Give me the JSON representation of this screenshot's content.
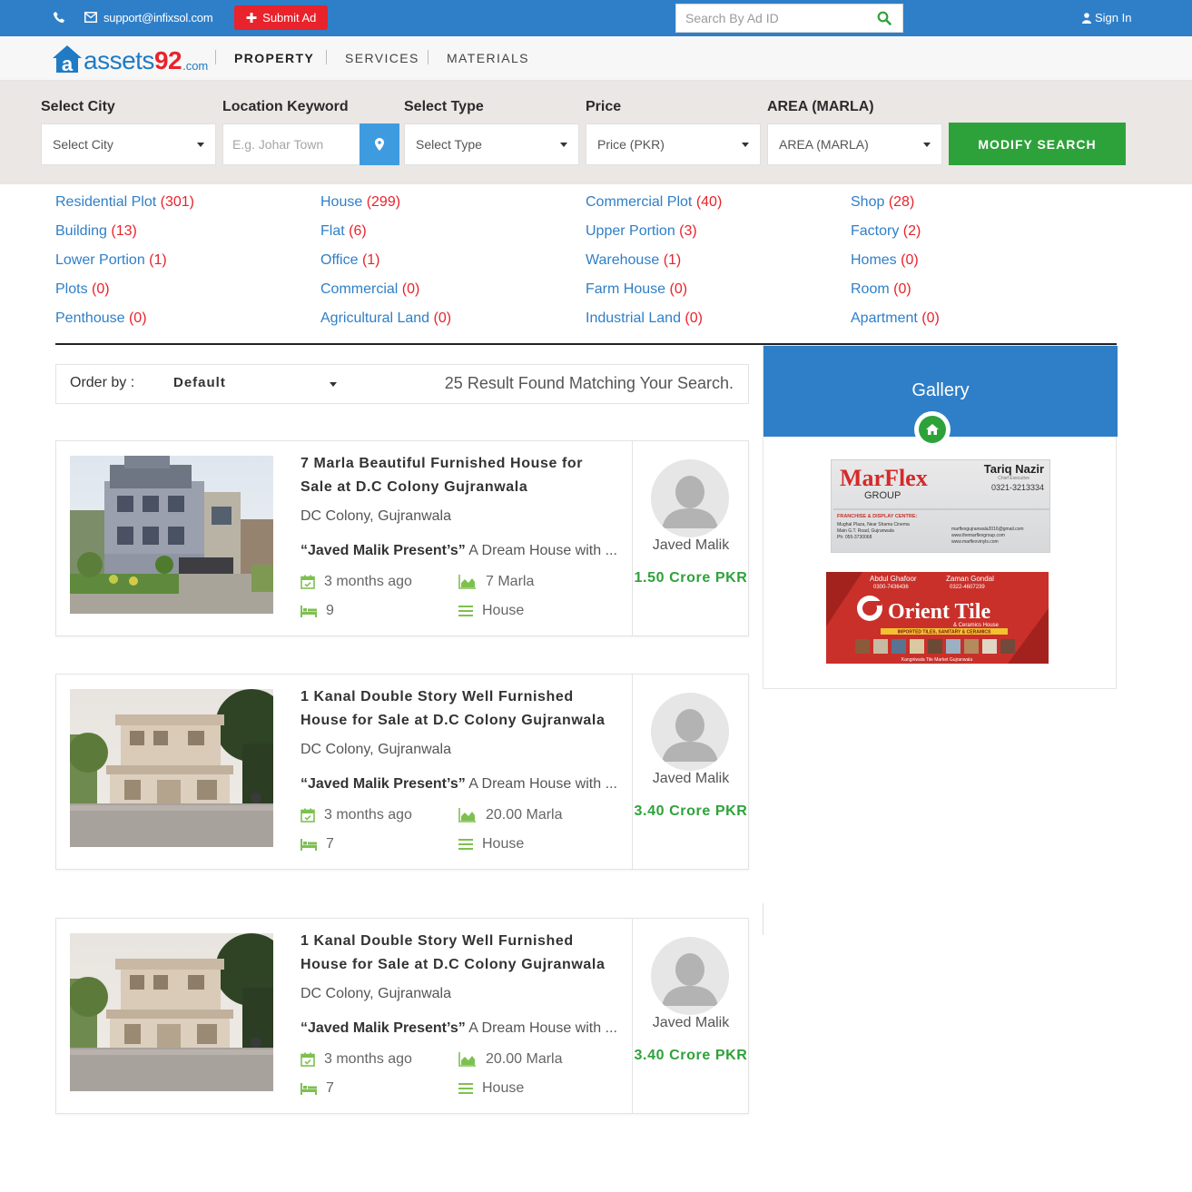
{
  "topbar": {
    "email": "support@infixsol.com",
    "submit_label": "Submit Ad",
    "search_placeholder": "Search By Ad ID",
    "signin_label": "Sign In",
    "bg_color": "#2f7fc8",
    "submit_color": "#e8232c"
  },
  "logo": {
    "part1": "assets",
    "part2": "92",
    "suffix": ".com"
  },
  "nav": {
    "items": [
      "PROPERTY",
      "SERVICES",
      "MATERIALS"
    ],
    "active": "PROPERTY"
  },
  "filter": {
    "city_label": "Select City",
    "city_value": "Select City",
    "keyword_label": "Location Keyword",
    "keyword_placeholder": "E.g. Johar Town",
    "type_label": "Select Type",
    "type_value": "Select Type",
    "price_label": "Price",
    "price_value": "Price (PKR)",
    "area_label": "AREA (MARLA)",
    "area_value": "AREA (MARLA)",
    "modify_label": "MODIFY SEARCH",
    "modify_color": "#2ea23a"
  },
  "categories": [
    {
      "name": "Residential Plot",
      "count": "(301)"
    },
    {
      "name": "House",
      "count": "(299)"
    },
    {
      "name": "Commercial Plot",
      "count": "(40)"
    },
    {
      "name": "Shop",
      "count": "(28)"
    },
    {
      "name": "Building",
      "count": "(13)"
    },
    {
      "name": "Flat",
      "count": "(6)"
    },
    {
      "name": "Upper Portion",
      "count": "(3)"
    },
    {
      "name": "Factory",
      "count": "(2)"
    },
    {
      "name": "Lower Portion",
      "count": "(1)"
    },
    {
      "name": "Office",
      "count": "(1)"
    },
    {
      "name": "Warehouse",
      "count": "(1)"
    },
    {
      "name": "Homes",
      "count": "(0)"
    },
    {
      "name": "Plots",
      "count": "(0)"
    },
    {
      "name": "Commercial",
      "count": "(0)"
    },
    {
      "name": "Farm House",
      "count": "(0)"
    },
    {
      "name": "Room",
      "count": "(0)"
    },
    {
      "name": "Penthouse",
      "count": "(0)"
    },
    {
      "name": "Agricultural Land",
      "count": "(0)"
    },
    {
      "name": "Industrial Land",
      "count": "(0)"
    },
    {
      "name": "Apartment",
      "count": "(0)"
    }
  ],
  "results": {
    "order_label": "Order by :",
    "order_value": "Default",
    "count_text": "25 Result Found Matching Your Search."
  },
  "listings": [
    {
      "title_line1": "7 Marla Beautiful Furnished House for",
      "title_line2": "Sale at D.C Colony Gujranwala",
      "location": "DC Colony, Gujranwala",
      "desc_bold": "“Javed Malik Present’s”",
      "desc_rest": " A Dream House with ...",
      "posted": "3 months ago",
      "area": "7 Marla",
      "beds": "9",
      "type": "House",
      "agent": "Javed Malik",
      "price": "1.50 Crore PKR"
    },
    {
      "title_line1": "1 Kanal Double Story Well Furnished",
      "title_line2": "House for Sale at D.C Colony Gujranwala",
      "location": "DC Colony, Gujranwala",
      "desc_bold": "“Javed Malik Present’s”",
      "desc_rest": " A Dream House with ...",
      "posted": "3 months ago",
      "area": "20.00 Marla",
      "beds": "7",
      "type": "House",
      "agent": "Javed Malik",
      "price": "3.40 Crore PKR"
    },
    {
      "title_line1": "1 Kanal Double Story Well Furnished",
      "title_line2": "House for Sale at D.C Colony Gujranwala",
      "location": "DC Colony, Gujranwala",
      "desc_bold": "“Javed Malik Present’s”",
      "desc_rest": " A Dream House with ...",
      "posted": "3 months ago",
      "area": "20.00 Marla",
      "beds": "7",
      "type": "House",
      "agent": "Javed Malik",
      "price": "3.40 Crore PKR"
    }
  ],
  "gallery": {
    "title": "Gallery",
    "ad1": {
      "brand": "MarFlex",
      "brand_sub": "GROUP",
      "person": "Tariq Nazir",
      "person_role": "Chief Executive",
      "phone": "0321-3213334",
      "franchise": "FRANCHISE & DISPLAY CENTRE:",
      "address1": "Mughal Plaza, Near Shama Cinema",
      "address2": "Main G.T. Road, Gujranwala",
      "address3": "Ph: 055-3730068",
      "email": "marflexgujranwala2016@gmail.com",
      "web1": "www.themarflexgroup.com",
      "web2": "www.marflexvinyls.com"
    },
    "ad2": {
      "name1": "Abdul Ghafoor",
      "phone1": "0300-7436436",
      "name2": "Zaman Gondal",
      "phone2": "0322-4607239",
      "brand": "Orient Tile",
      "brand_sub": "& Ceramics House",
      "tagline": "IMPORTED TILES, SANITARY & CERAMICS",
      "footer": "Kangniwala Tile Market Gujranwala"
    }
  }
}
